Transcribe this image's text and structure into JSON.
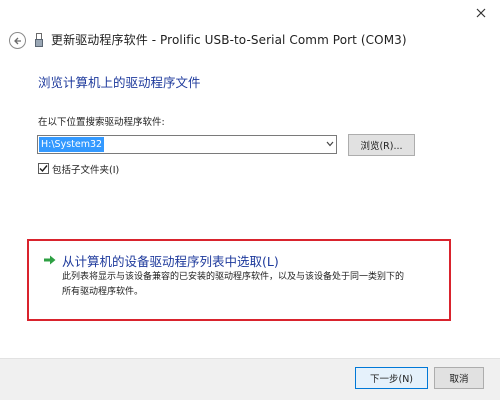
{
  "window": {
    "icons": {
      "close": "close-icon",
      "back": "back-arrow-icon",
      "device": "usb-device-icon"
    }
  },
  "header": {
    "title": "更新驱动程序软件 - Prolific USB-to-Serial Comm Port (COM3)"
  },
  "main": {
    "title": "浏览计算机上的驱动程序文件",
    "search_label": "在以下位置搜索驱动程序软件:",
    "path_value": "H:\\System32",
    "browse_label": "浏览(R)...",
    "include_subfolders_label": "包括子文件夹(I)",
    "include_subfolders_checked": true
  },
  "pick": {
    "title": "从计算机的设备驱动程序列表中选取(L)",
    "desc_line1": "此列表将显示与该设备兼容的已安装的驱动程序软件，以及与该设备处于同一类别下的",
    "desc_line2": "所有驱动程序软件。",
    "icon": "green-arrow-icon"
  },
  "footer": {
    "next_label": "下一步(N)",
    "cancel_label": "取消"
  },
  "colors": {
    "accent_title": "#1e3a9c",
    "highlight_box": "#d9232d",
    "selection": "#3399ff",
    "arrow_green": "#2ea043"
  }
}
